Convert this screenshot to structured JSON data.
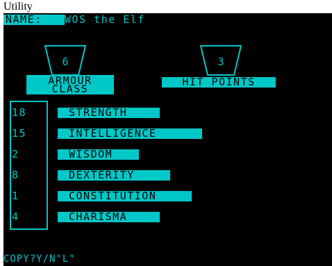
{
  "window": {
    "title": "Utility"
  },
  "character": {
    "name_label": "NAME:",
    "name_value": "WOS the Elf"
  },
  "armour_class": {
    "value": "6",
    "label_line1": "ARMOUR",
    "label_line2": "CLASS"
  },
  "hit_points": {
    "value": "3",
    "label": "HIT POINTS"
  },
  "stats": [
    {
      "value": "18",
      "label": "STRENGTH"
    },
    {
      "value": "15",
      "label": "INTELLIGENCE"
    },
    {
      "value": "2",
      "label": "WISDOM"
    },
    {
      "value": "8",
      "label": "DEXTERITY"
    },
    {
      "value": "1",
      "label": "CONSTITUTION"
    },
    {
      "value": "4",
      "label": "CHARISMA"
    }
  ],
  "prompt": {
    "text": "COPY?Y/N\"L\""
  },
  "colors": {
    "screen_bg": "#000000",
    "accent": "#00c8c8",
    "text_on_accent": "#000000"
  }
}
